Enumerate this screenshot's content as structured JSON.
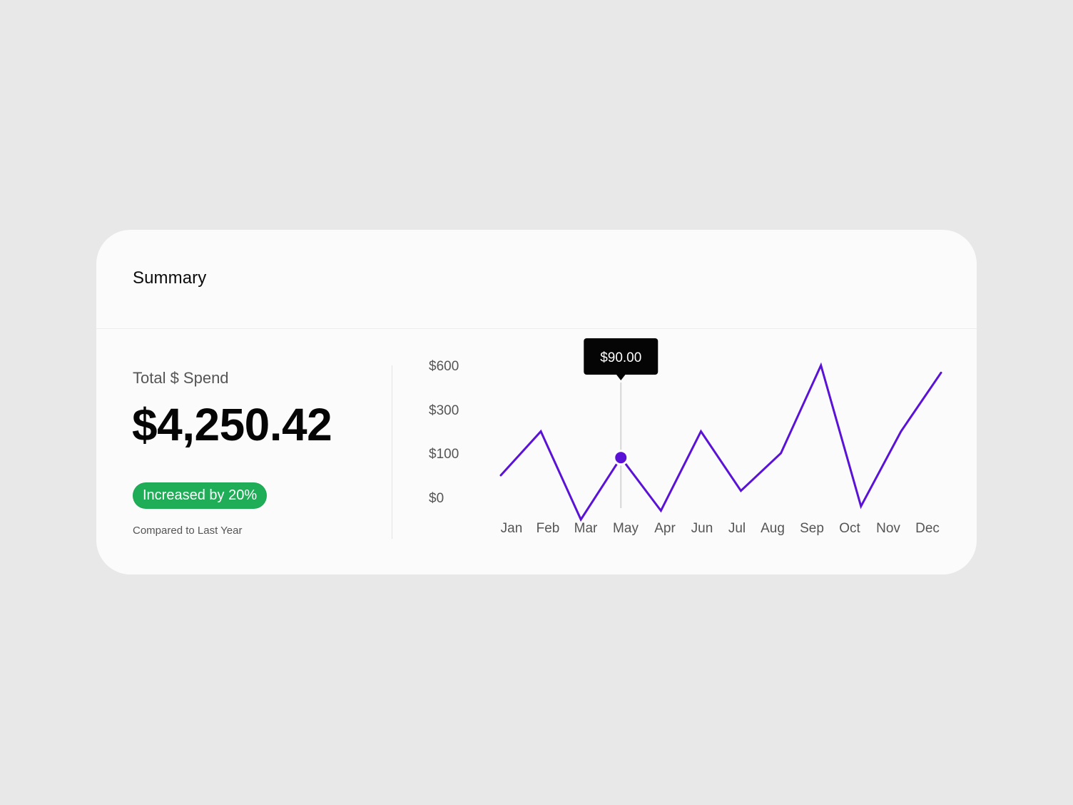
{
  "card": {
    "title": "Summary"
  },
  "metric": {
    "label": "Total $ Spend",
    "value": "$4,250.42",
    "badge": "Increased by 20%",
    "comparison": "Compared to Last Year"
  },
  "colors": {
    "line": "#5a13d6",
    "badge": "#1fad57",
    "tooltip_bg": "#050505"
  },
  "chart_data": {
    "type": "line",
    "categories": [
      "Jan",
      "Feb",
      "Mar",
      "May",
      "Apr",
      "Jun",
      "Jul",
      "Aug",
      "Sep",
      "Oct",
      "Nov",
      "Dec"
    ],
    "y_tick_labels": [
      "$600",
      "$300",
      "$100",
      "$0"
    ],
    "series": [
      {
        "values": [
          50,
          200,
          -50,
          90,
          -30,
          200,
          15,
          100,
          600,
          -20,
          200,
          550
        ]
      }
    ],
    "highlight": {
      "category": "May",
      "label": "$90.00"
    },
    "grid": false,
    "legend": "none"
  }
}
